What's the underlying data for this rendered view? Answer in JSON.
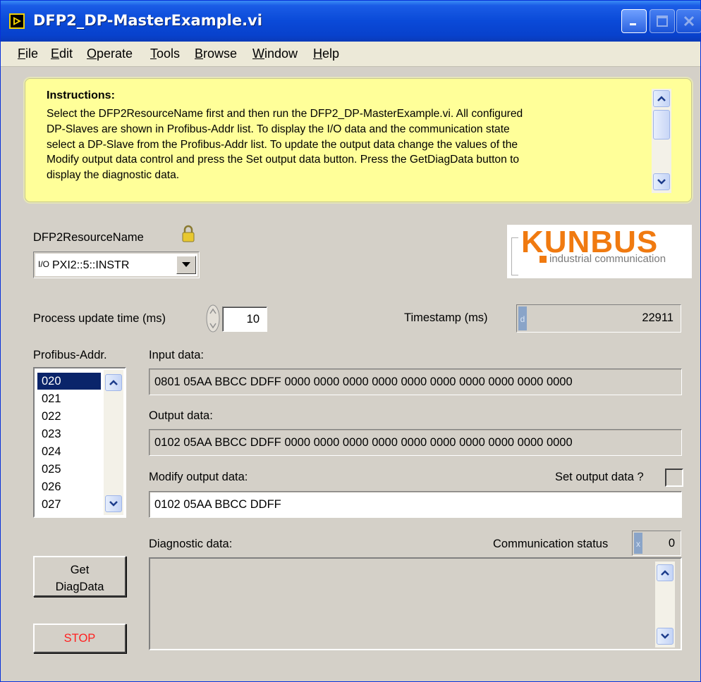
{
  "window": {
    "title": "DFP2_DP-MasterExample.vi",
    "controls": [
      "minimize-icon",
      "maximize-icon",
      "close-icon"
    ]
  },
  "menu": {
    "items": [
      "File",
      "Edit",
      "Operate",
      "Tools",
      "Browse",
      "Window",
      "Help"
    ]
  },
  "instructions": {
    "title": "Instructions:",
    "lines": [
      "Select the DFP2ResourceName first and then run the DFP2_DP-MasterExample.vi. All configured",
      "DP-Slaves are shown in Profibus-Addr  list. To display the I/O data and the communication state",
      "select a DP-Slave from the Profibus-Addr list. To update the output data change the values of the",
      "Modify output data control and press the Set output data button. Press the GetDiagData button to",
      "display the diagnostic data."
    ]
  },
  "resource": {
    "label": "DFP2ResourceName",
    "prefix": "I/O",
    "value": "PXI2::5::INSTR"
  },
  "logo": {
    "name": "KUNBUS",
    "tagline": "industrial communication",
    "color": "#f07a10"
  },
  "process": {
    "label": "Process update time (ms)",
    "value": "10"
  },
  "timestamp": {
    "label": "Timestamp (ms)",
    "radix": "d",
    "value": "22911"
  },
  "profibus": {
    "label": "Profibus-Addr.",
    "items": [
      "020",
      "021",
      "022",
      "023",
      "024",
      "025",
      "026",
      "027"
    ],
    "selected": "020"
  },
  "input_data": {
    "label": "Input data:",
    "value": "0801 05AA BBCC DDFF 0000 0000 0000 0000 0000 0000 0000 0000 0000 0000"
  },
  "output_data": {
    "label": "Output data:",
    "value": "0102 05AA BBCC DDFF 0000 0000 0000 0000 0000 0000 0000 0000 0000 0000"
  },
  "modify_output": {
    "label": "Modify output data:",
    "value": "0102 05AA BBCC DDFF"
  },
  "set_output": {
    "label": "Set output data ?",
    "checked": false
  },
  "diagnostic": {
    "label": "Diagnostic data:",
    "value": ""
  },
  "comm_status": {
    "label": "Communication status",
    "radix": "x",
    "value": "0"
  },
  "buttons": {
    "get_diag_line1": "Get",
    "get_diag_line2": "DiagData",
    "stop": "STOP"
  },
  "colors": {
    "panel": "#d4d0c8",
    "instructions_bg": "#ffff99",
    "titlebar": "#0a4ad8",
    "selection": "#0a246a",
    "stop_text": "#ff2020"
  }
}
